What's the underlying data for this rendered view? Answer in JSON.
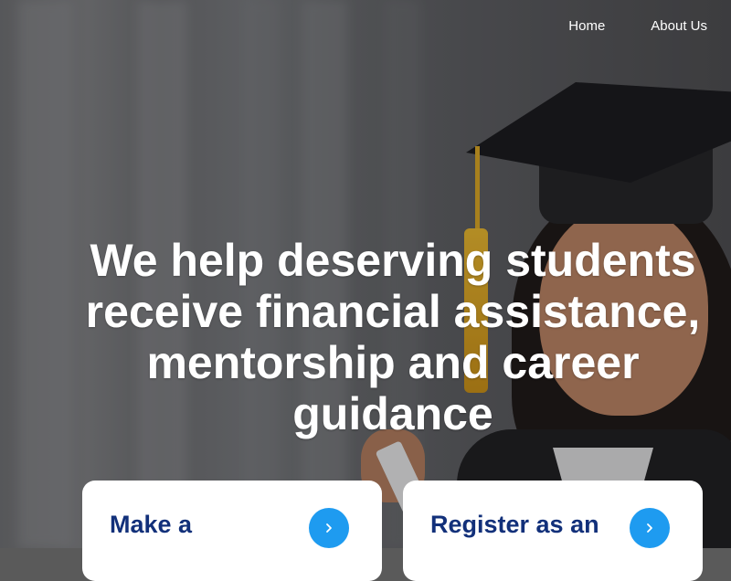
{
  "nav": {
    "items": [
      {
        "label": "Home"
      },
      {
        "label": "About Us"
      }
    ]
  },
  "hero": {
    "headline": "We help deserving students receive financial assistance, mentorship and career guidance"
  },
  "cards": [
    {
      "title": "Make a",
      "icon": "chevron-right-icon"
    },
    {
      "title": "Register as an",
      "icon": "chevron-right-icon"
    }
  ],
  "colors": {
    "card_title": "#12307a",
    "accent": "#1e9bf0",
    "card_bg": "#ffffff",
    "headline": "#ffffff"
  }
}
